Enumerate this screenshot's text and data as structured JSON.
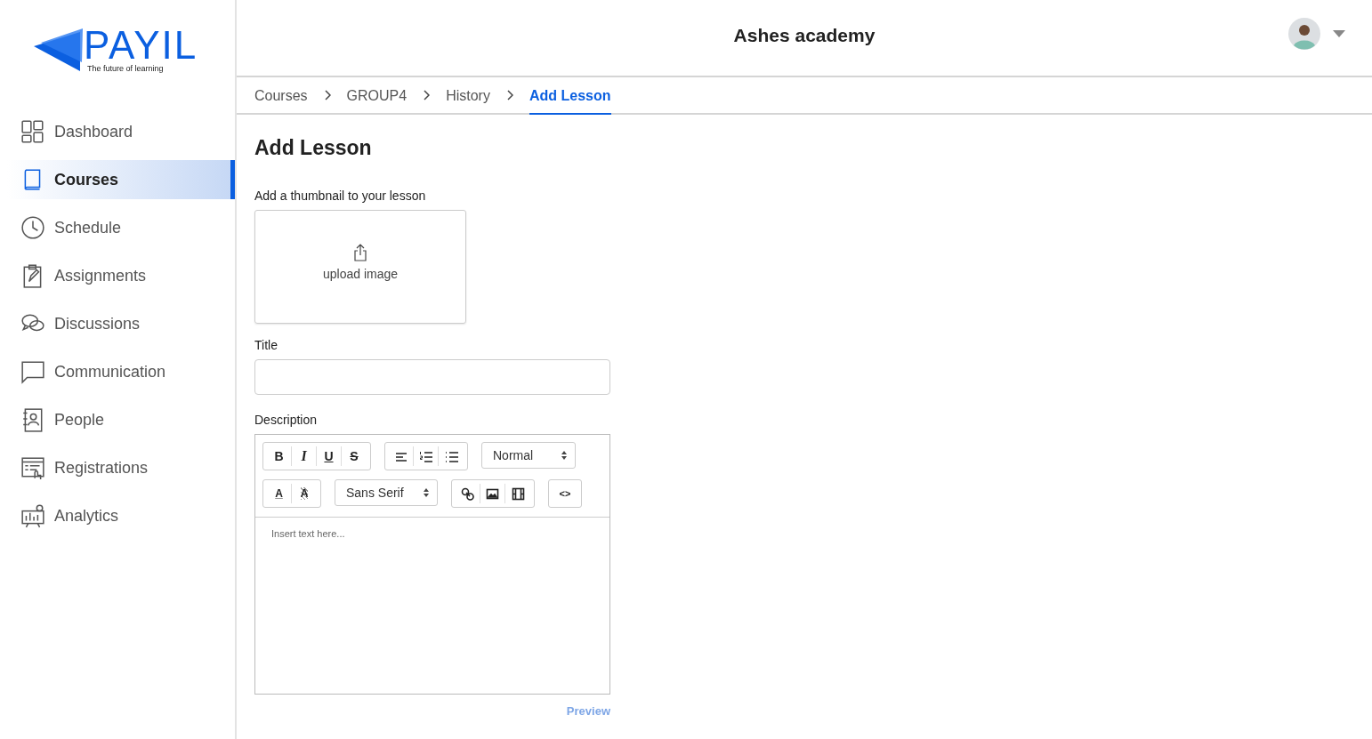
{
  "logo": {
    "name": "PAYIL",
    "tagline": "The future of learning"
  },
  "sidebar": {
    "items": [
      {
        "label": "Dashboard",
        "selected": false
      },
      {
        "label": "Courses",
        "selected": true
      },
      {
        "label": "Schedule",
        "selected": false
      },
      {
        "label": "Assignments",
        "selected": false
      },
      {
        "label": "Discussions",
        "selected": false
      },
      {
        "label": "Communication",
        "selected": false
      },
      {
        "label": "People",
        "selected": false
      },
      {
        "label": "Registrations",
        "selected": false
      },
      {
        "label": "Analytics",
        "selected": false
      }
    ]
  },
  "header": {
    "title": "Ashes academy"
  },
  "breadcrumbs": [
    {
      "label": "Courses",
      "selected": false
    },
    {
      "label": "GROUP4",
      "selected": false
    },
    {
      "label": "History",
      "selected": false
    },
    {
      "label": "Add Lesson",
      "selected": true
    }
  ],
  "form": {
    "heading": "Add Lesson",
    "thumbnail_label": "Add a thumbnail to your lesson",
    "upload_text": "upload image",
    "title_label": "Title",
    "description_label": "Description",
    "editor": {
      "toolbar": [
        [
          {
            "kind": "buttons",
            "items": [
              {
                "kind": "bold",
                "label": "B"
              },
              {
                "kind": "italic",
                "label": "I"
              },
              {
                "kind": "underline",
                "label": "U"
              },
              {
                "kind": "strike",
                "label": "S"
              }
            ]
          },
          {
            "kind": "buttons",
            "items": [
              {
                "kind": "align-left"
              },
              {
                "kind": "ordered-list"
              },
              {
                "kind": "bullet-list"
              }
            ]
          },
          {
            "kind": "select",
            "value": "Normal"
          }
        ],
        [
          {
            "kind": "buttons",
            "items": [
              {
                "kind": "text-color",
                "label": "A"
              },
              {
                "kind": "highlight",
                "label": "A"
              }
            ]
          },
          {
            "kind": "select",
            "value": "Sans Serif"
          },
          {
            "kind": "buttons",
            "items": [
              {
                "kind": "link"
              },
              {
                "kind": "image"
              },
              {
                "kind": "video"
              }
            ]
          },
          {
            "kind": "buttons",
            "items": [
              {
                "kind": "code",
                "label": "<>"
              }
            ]
          }
        ]
      ],
      "placeholder": "Insert text here..."
    },
    "preview": "Preview"
  }
}
